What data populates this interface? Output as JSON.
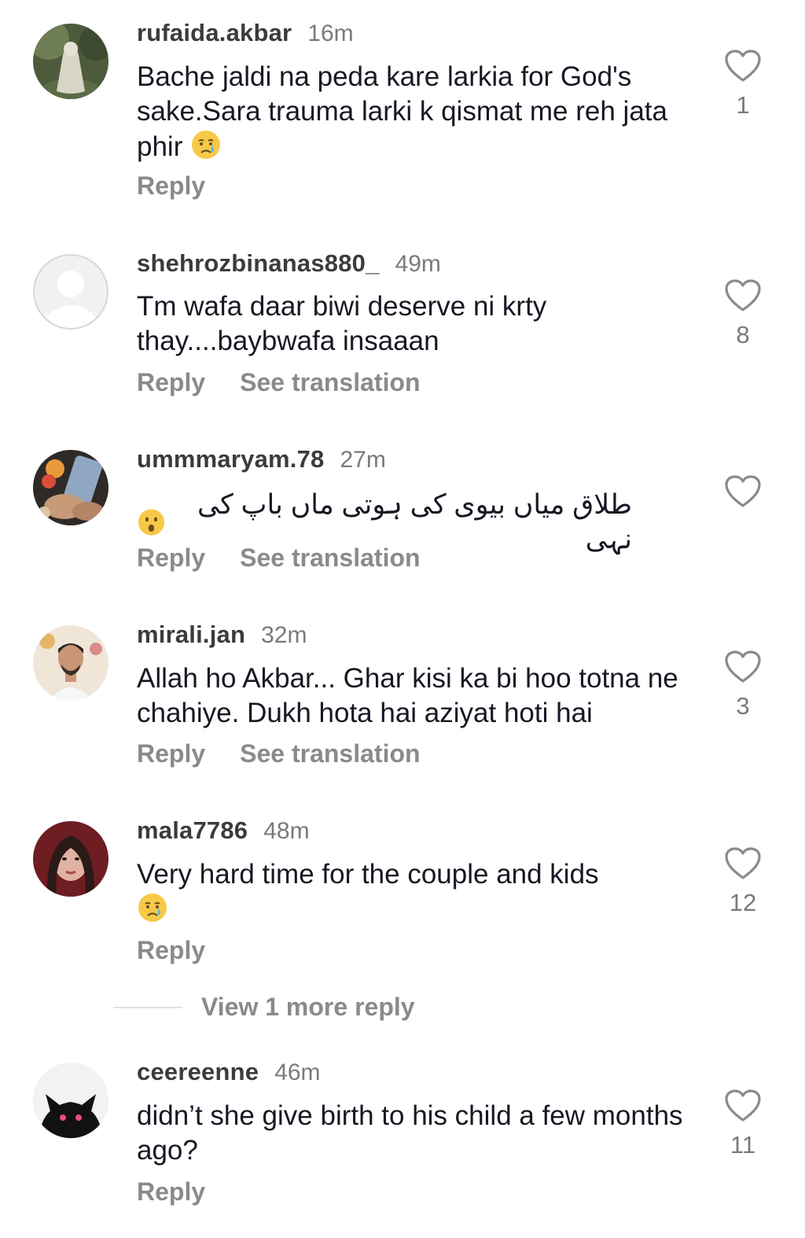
{
  "comments": [
    {
      "username": "rufaida.akbar",
      "time": "16m",
      "text": "Bache jaldi na peda kare larkia for God's sake.Sara trauma larki k qismat me reh jata phir",
      "emoji": "crying-face-emoji",
      "actions": [
        "Reply"
      ],
      "likes": "1",
      "avatar": "avatar-photo-veiled-woman"
    },
    {
      "username": "shehrozbinanas880_",
      "time": "49m",
      "text": "Tm wafa daar biwi deserve ni krty thay....baybwafa insaaan",
      "actions": [
        "Reply",
        "See translation"
      ],
      "likes": "8",
      "avatar": "default-avatar-icon"
    },
    {
      "username": "ummmaryam.78",
      "time": "27m",
      "text": "طلاق میاں بیوی کی ہوتی ماں باپ کی نہی",
      "emoji": "astonished-face-emoji",
      "actions": [
        "Reply",
        "See translation"
      ],
      "likes": "",
      "avatar": "avatar-photo-hands-phone"
    },
    {
      "username": "mirali.jan",
      "time": "32m",
      "text": "Allah ho Akbar... Ghar kisi ka bi hoo totna ne chahiye. Dukh hota hai aziyat hoti hai",
      "actions": [
        "Reply",
        "See translation"
      ],
      "likes": "3",
      "avatar": "avatar-photo-man"
    },
    {
      "username": "mala7786",
      "time": "48m",
      "text": "Very hard time for the couple and kids",
      "emoji": "crying-face-emoji",
      "actions": [
        "Reply"
      ],
      "likes": "12",
      "avatar": "avatar-photo-woman"
    },
    {
      "username": "ceereenne",
      "time": "46m",
      "text": "didn’t she give birth to his child a few months ago?",
      "actions": [
        "Reply"
      ],
      "likes": "11",
      "avatar": "avatar-photo-black-cat"
    }
  ],
  "view_more_replies": "View 1 more reply",
  "colors": {
    "text": "#161823",
    "username": "#3b3b3b",
    "muted": "#8a8a8a",
    "emoji_yellow": "#f7c948"
  }
}
